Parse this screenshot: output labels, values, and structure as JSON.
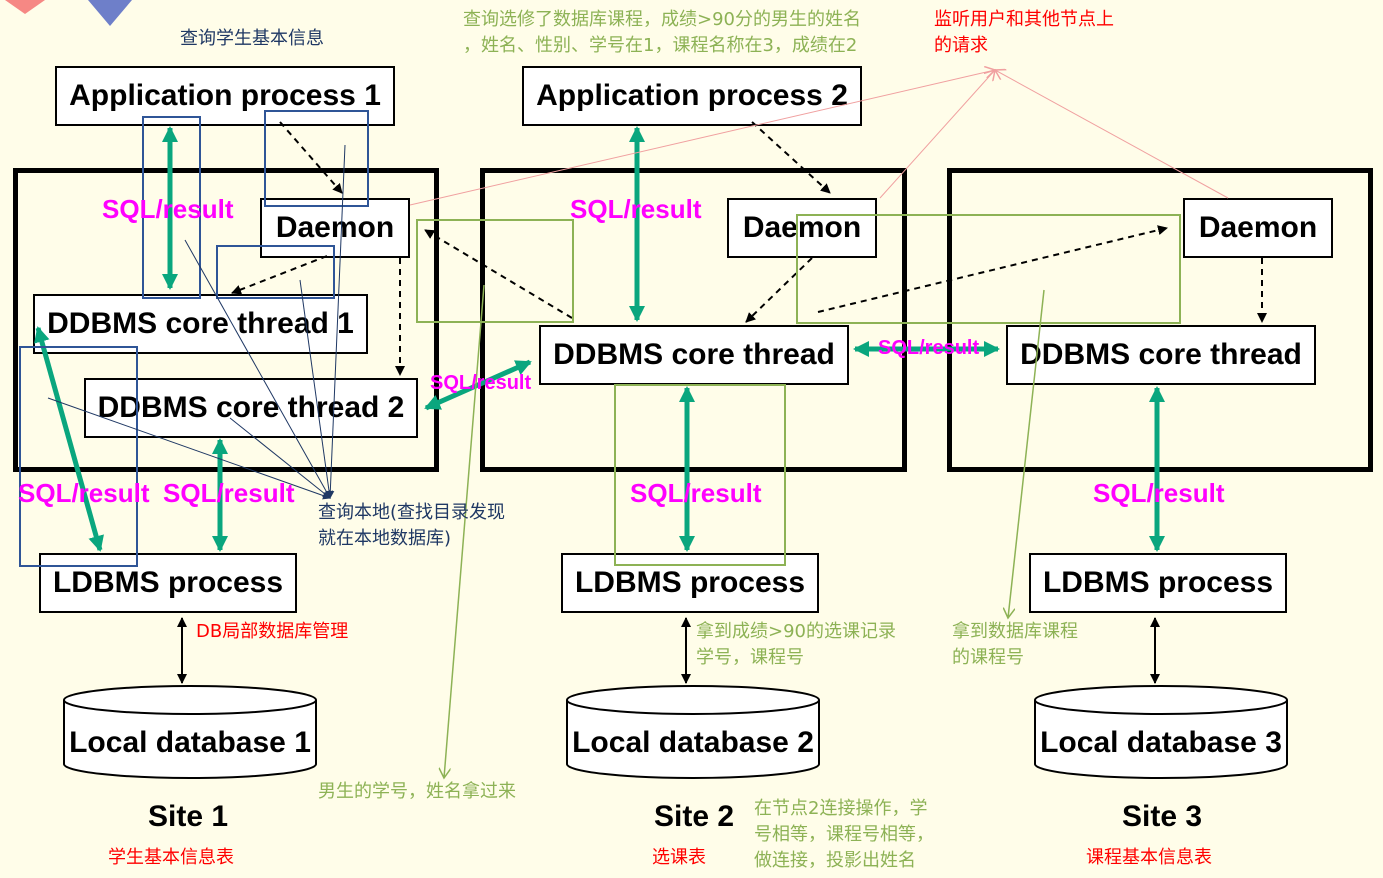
{
  "processes": {
    "app1": "Application process 1",
    "app2": "Application process 2",
    "daemon1": "Daemon",
    "daemon2": "Daemon",
    "daemon3": "Daemon",
    "core1a": "DDBMS core thread 1",
    "core1b": "DDBMS core thread 2",
    "core2": "DDBMS core thread",
    "core3": "DDBMS core thread",
    "ldbms1": "LDBMS process",
    "ldbms2": "LDBMS process",
    "ldbms3": "LDBMS process"
  },
  "databases": {
    "db1": "Local database 1",
    "db2": "Local database 2",
    "db3": "Local database 3"
  },
  "sites": {
    "site1": "Site 1",
    "site2": "Site 2",
    "site3": "Site 3",
    "site1_table": "学生基本信息表",
    "site2_table": "选课表",
    "site3_table": "课程基本信息表"
  },
  "sql_label": "SQL/result",
  "annotations": {
    "query_student": "查询学生基本信息",
    "query_course_line1": "查询选修了数据库课程，成绩>90分的男生的姓名",
    "query_course_line2": "，姓名、性别、学号在1，课程名称在3，成绩在2",
    "listen_line1": "监听用户和其他节点上",
    "listen_line2": "的请求",
    "local_query_line1": "查询本地(查找目录发现",
    "local_query_line2": "就在本地数据库)",
    "db_local_mgmt": "DB局部数据库管理",
    "get_records_line1": "拿到成绩>90的选课记录",
    "get_records_line2": "学号，课程号",
    "get_course_line1": "拿到数据库课程",
    "get_course_line2": "的课程号",
    "male_fetch": "男生的学号，姓名拿过来",
    "join_line1": "在节点2连接操作，学",
    "join_line2": "号相等，课程号相等，",
    "join_line3": "做连接，投影出姓名"
  },
  "colors": {
    "background": "#fffde9",
    "sql_label": "#ff00ff",
    "sql_arrow": "#0aa67e",
    "note_green": "#8db255",
    "note_red": "#ff0000",
    "note_blue": "#1f3864",
    "highlight_blue": "#2f5597"
  }
}
